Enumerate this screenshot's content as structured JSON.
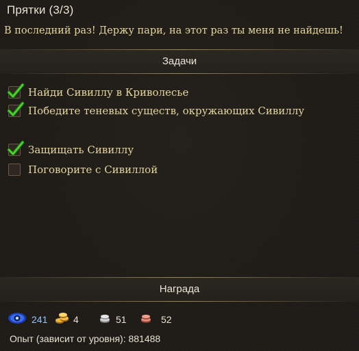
{
  "quest": {
    "title": "Прятки  (3/3)",
    "description": "В последний раз! Держу пари, на этот раз ты меня не найдешь!"
  },
  "objectives_header": "Задачи",
  "objectives": [
    {
      "text": "Найди Сивиллу в Криволесье",
      "completed": true
    },
    {
      "text": "Победите теневых существ, окружающих Сивиллу",
      "completed": true
    },
    {
      "text": "Защищать Сивиллу",
      "completed": true
    },
    {
      "text": "Поговорите с Сивиллой",
      "completed": false
    }
  ],
  "reward_header": "Награда",
  "rewards": [
    {
      "icon": "blue-eye-orb-icon",
      "value": "241",
      "color": "#8fc6ff"
    },
    {
      "icon": "gold-coins-icon",
      "value": "4",
      "color": "#e9e2d2"
    },
    {
      "icon": "silver-coins-icon",
      "value": "51",
      "color": "#e9e2d2"
    },
    {
      "icon": "copper-coins-icon",
      "value": "52",
      "color": "#e9e2d2"
    }
  ],
  "experience": {
    "label": "Опыт (зависит от уровня):",
    "value": "881488"
  },
  "colors": {
    "quest_text": "#e6d59c",
    "check_green": "#3fbf2a",
    "background": "#1e1b17"
  }
}
